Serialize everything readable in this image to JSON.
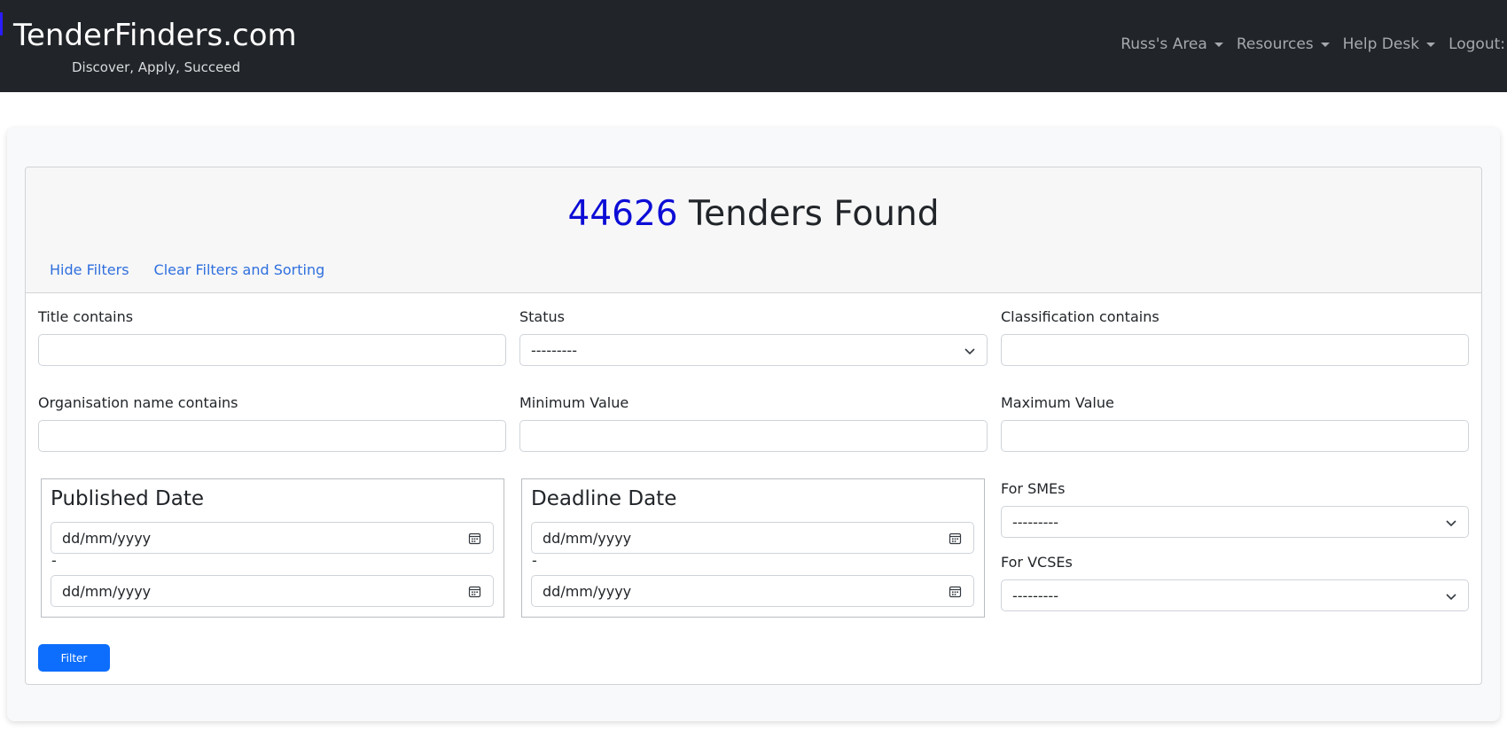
{
  "brand": {
    "title": "TenderFinders.com",
    "tagline": "Discover, Apply, Succeed"
  },
  "nav": {
    "items": [
      {
        "label": "Russ's Area",
        "dropdown": true
      },
      {
        "label": "Resources",
        "dropdown": true
      },
      {
        "label": "Help Desk",
        "dropdown": true
      },
      {
        "label": "Logout:",
        "dropdown": false
      }
    ]
  },
  "results": {
    "count": "44626",
    "label": "Tenders Found"
  },
  "header_links": {
    "hide_filters": "Hide Filters",
    "clear_filters": "Clear Filters and Sorting"
  },
  "filters": {
    "title_contains": {
      "label": "Title contains",
      "value": ""
    },
    "status": {
      "label": "Status",
      "selected": "---------"
    },
    "classification_contains": {
      "label": "Classification contains",
      "value": ""
    },
    "organisation_contains": {
      "label": "Organisation name contains",
      "value": ""
    },
    "minimum_value": {
      "label": "Minimum Value",
      "value": ""
    },
    "maximum_value": {
      "label": "Maximum Value",
      "value": ""
    },
    "published_date": {
      "legend": "Published Date",
      "from_placeholder": "dd/mm/yyyy",
      "separator": "-",
      "to_placeholder": "dd/mm/yyyy"
    },
    "deadline_date": {
      "legend": "Deadline Date",
      "from_placeholder": "dd/mm/yyyy",
      "separator": "-",
      "to_placeholder": "dd/mm/yyyy"
    },
    "for_smes": {
      "label": "For SMEs",
      "selected": "---------"
    },
    "for_vcses": {
      "label": "For VCSEs",
      "selected": "---------"
    }
  },
  "filter_button": {
    "label": "Filter"
  },
  "colors": {
    "navbar_bg": "#212529",
    "count_accent": "#0d0dd6",
    "link": "#2f6fde",
    "primary_button": "#0d6efd"
  }
}
